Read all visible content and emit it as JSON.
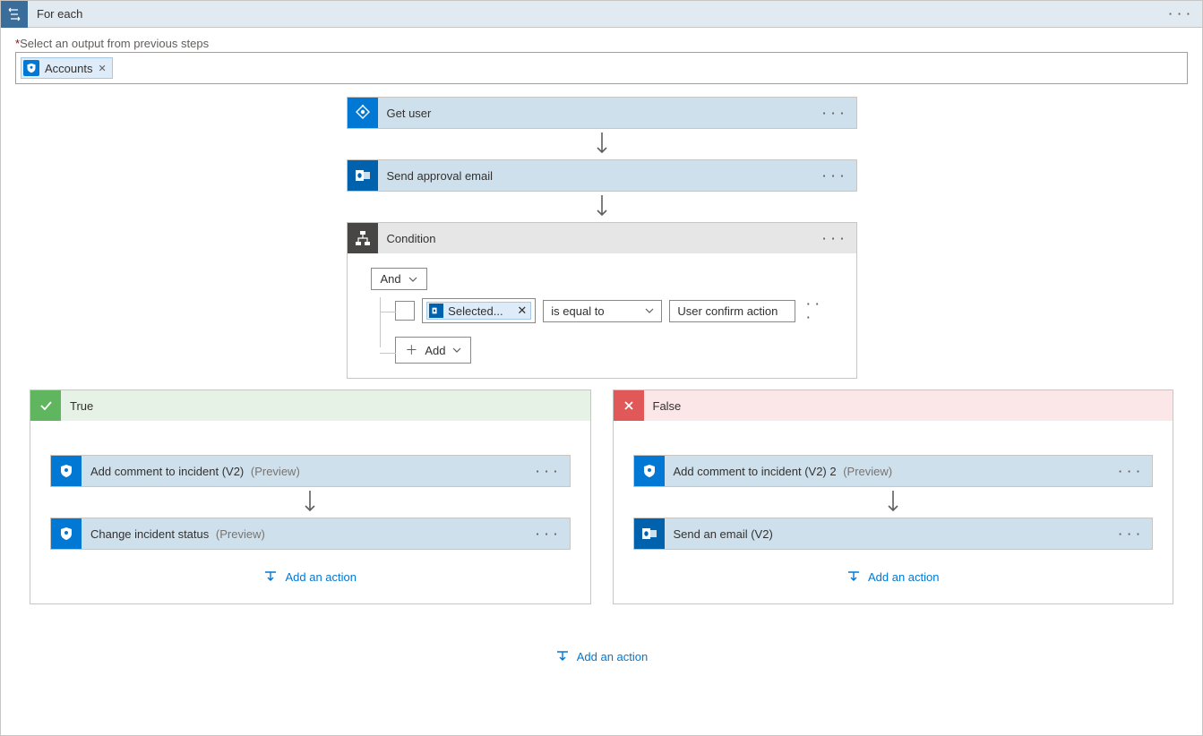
{
  "header": {
    "title": "For each"
  },
  "input": {
    "label": "Select an output from previous steps",
    "token": "Accounts"
  },
  "steps": {
    "getUser": "Get user",
    "sendApproval": "Send approval email",
    "condition": "Condition"
  },
  "condition": {
    "group": "And",
    "tokenLabel": "Selected...",
    "operator": "is equal to",
    "value": "User confirm action",
    "addLabel": "Add"
  },
  "branches": {
    "trueLabel": "True",
    "falseLabel": "False",
    "true": {
      "step1": {
        "name": "Add comment to incident (V2)",
        "suffix": "(Preview)"
      },
      "step2": {
        "name": "Change incident status",
        "suffix": "(Preview)"
      }
    },
    "false": {
      "step1": {
        "name": "Add comment to incident (V2) 2",
        "suffix": "(Preview)"
      },
      "step2": {
        "name": "Send an email (V2)",
        "suffix": ""
      }
    }
  },
  "actions": {
    "addAction": "Add an action"
  }
}
